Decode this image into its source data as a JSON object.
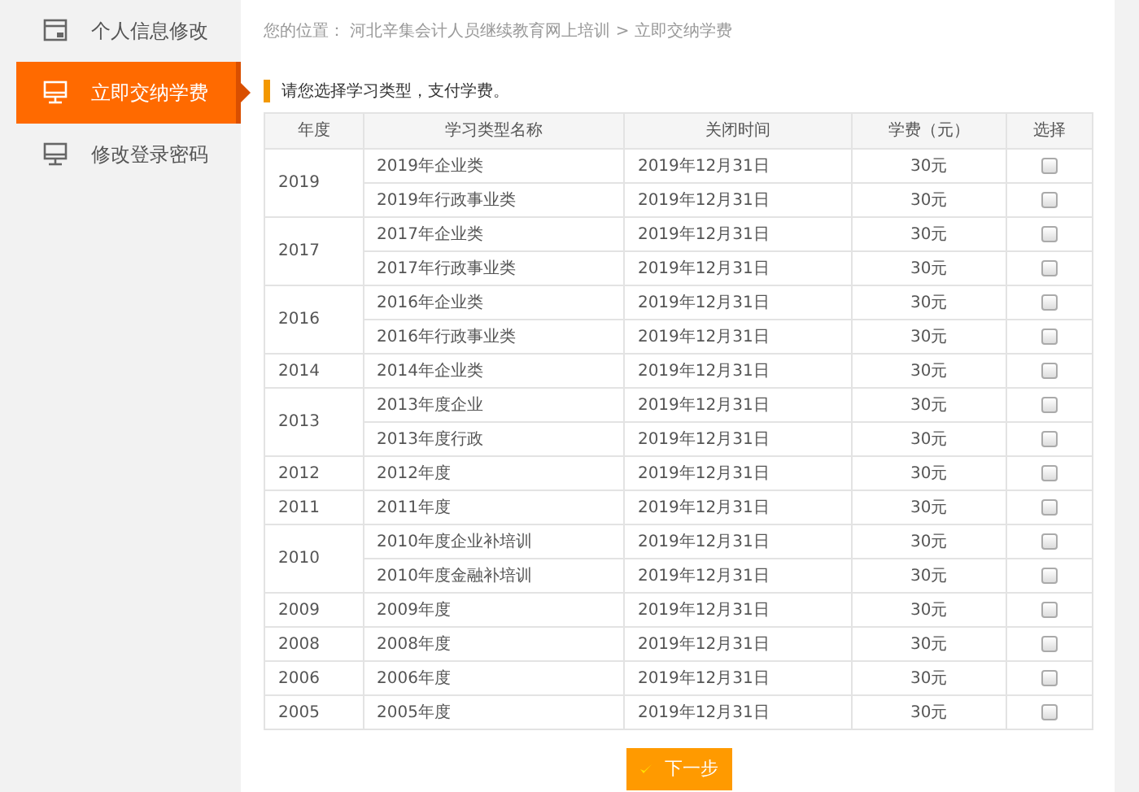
{
  "sidebar": {
    "items": [
      {
        "label": "个人信息修改",
        "selected": false
      },
      {
        "label": "立即交纳学费",
        "selected": true
      },
      {
        "label": "修改登录密码",
        "selected": false
      }
    ]
  },
  "breadcrumb": {
    "prefix": "您的位置：",
    "path": "河北辛集会计人员继续教育网上培训 > 立即交纳学费"
  },
  "heading": "请您选择学习类型，支付学费。",
  "table": {
    "columns": [
      "年度",
      "学习类型名称",
      "关闭时间",
      "学费（元）",
      "选择"
    ],
    "groups": [
      {
        "year": "2019",
        "rows": [
          {
            "name": "2019年企业类",
            "close": "2019年12月31日",
            "fee": "30元",
            "checked": false
          },
          {
            "name": "2019年行政事业类",
            "close": "2019年12月31日",
            "fee": "30元",
            "checked": false
          }
        ]
      },
      {
        "year": "2017",
        "rows": [
          {
            "name": "2017年企业类",
            "close": "2019年12月31日",
            "fee": "30元",
            "checked": false
          },
          {
            "name": "2017年行政事业类",
            "close": "2019年12月31日",
            "fee": "30元",
            "checked": false
          }
        ]
      },
      {
        "year": "2016",
        "rows": [
          {
            "name": "2016年企业类",
            "close": "2019年12月31日",
            "fee": "30元",
            "checked": false
          },
          {
            "name": "2016年行政事业类",
            "close": "2019年12月31日",
            "fee": "30元",
            "checked": false
          }
        ]
      },
      {
        "year": "2014",
        "rows": [
          {
            "name": "2014年企业类",
            "close": "2019年12月31日",
            "fee": "30元",
            "checked": false
          }
        ]
      },
      {
        "year": "2013",
        "rows": [
          {
            "name": "2013年度企业",
            "close": "2019年12月31日",
            "fee": "30元",
            "checked": false
          },
          {
            "name": "2013年度行政",
            "close": "2019年12月31日",
            "fee": "30元",
            "checked": false
          }
        ]
      },
      {
        "year": "2012",
        "rows": [
          {
            "name": "2012年度",
            "close": "2019年12月31日",
            "fee": "30元",
            "checked": false
          }
        ]
      },
      {
        "year": "2011",
        "rows": [
          {
            "name": "2011年度",
            "close": "2019年12月31日",
            "fee": "30元",
            "checked": false
          }
        ]
      },
      {
        "year": "2010",
        "rows": [
          {
            "name": "2010年度企业补培训",
            "close": "2019年12月31日",
            "fee": "30元",
            "checked": false
          },
          {
            "name": "2010年度金融补培训",
            "close": "2019年12月31日",
            "fee": "30元",
            "checked": false
          }
        ]
      },
      {
        "year": "2009",
        "rows": [
          {
            "name": "2009年度",
            "close": "2019年12月31日",
            "fee": "30元",
            "checked": false
          }
        ]
      },
      {
        "year": "2008",
        "rows": [
          {
            "name": "2008年度",
            "close": "2019年12月31日",
            "fee": "30元",
            "checked": false
          }
        ]
      },
      {
        "year": "2006",
        "rows": [
          {
            "name": "2006年度",
            "close": "2019年12月31日",
            "fee": "30元",
            "checked": false
          }
        ]
      },
      {
        "year": "2005",
        "rows": [
          {
            "name": "2005年度",
            "close": "2019年12月31日",
            "fee": "30元",
            "checked": false
          }
        ]
      }
    ]
  },
  "next_button": "下一步"
}
